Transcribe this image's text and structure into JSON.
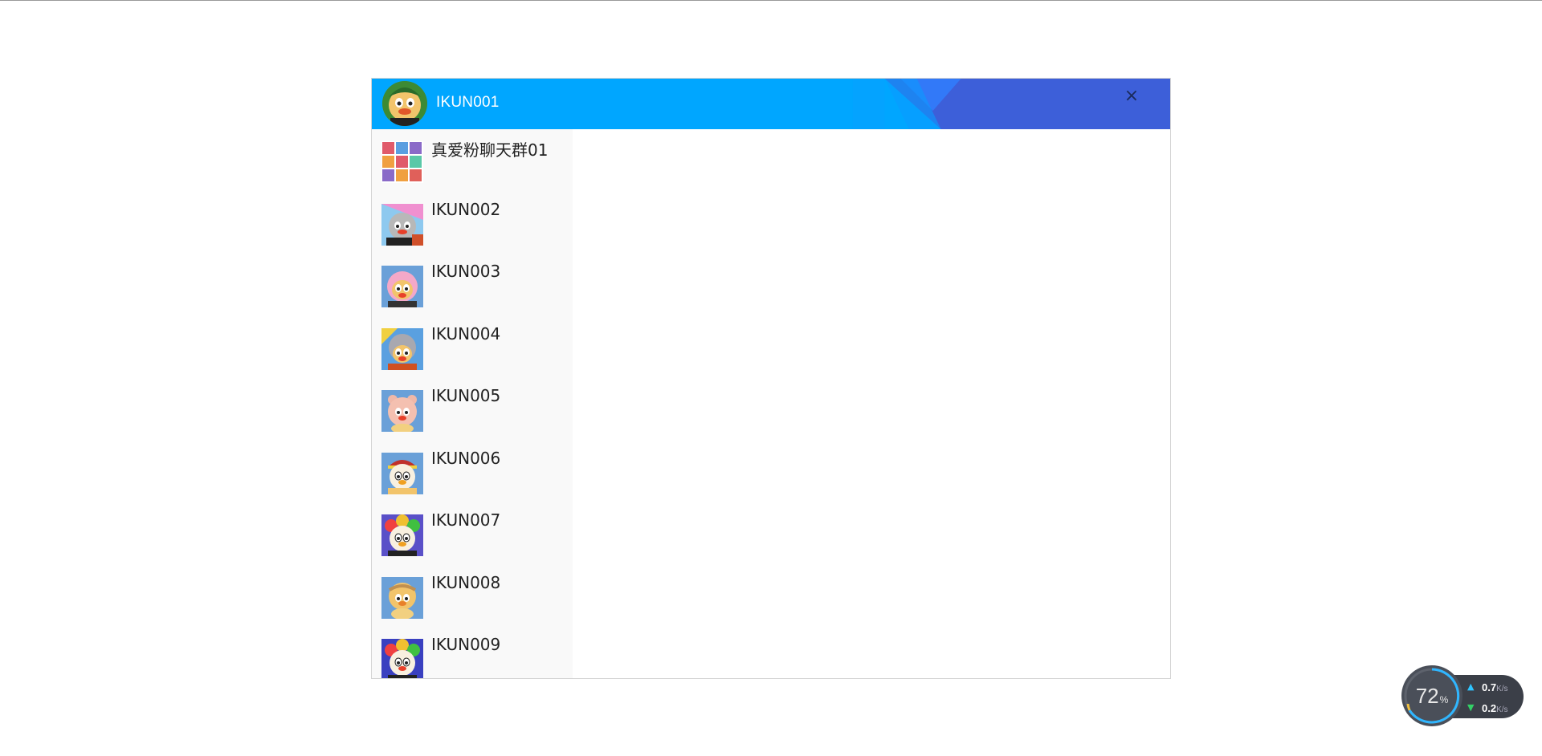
{
  "header": {
    "title": "IKUN001",
    "close_label": "×"
  },
  "contacts": [
    {
      "name": "真爱粉聊天群01",
      "avatar": "group-avatar"
    },
    {
      "name": "IKUN002",
      "avatar": "chick-avatar"
    },
    {
      "name": "IKUN003",
      "avatar": "chick-avatar"
    },
    {
      "name": "IKUN004",
      "avatar": "chick-avatar"
    },
    {
      "name": "IKUN005",
      "avatar": "chick-avatar"
    },
    {
      "name": "IKUN006",
      "avatar": "chick-avatar"
    },
    {
      "name": "IKUN007",
      "avatar": "chick-avatar"
    },
    {
      "name": "IKUN008",
      "avatar": "chick-avatar"
    },
    {
      "name": "IKUN009",
      "avatar": "chick-avatar"
    }
  ],
  "net_widget": {
    "cpu_value": "72",
    "cpu_unit": "%",
    "upload_value": "0.7",
    "upload_unit": "K/s",
    "download_value": "0.2",
    "download_unit": "K/s"
  },
  "colors": {
    "header_blue": "#00a6ff",
    "header_deep": "#3d5fd9",
    "sidebar_bg": "#f9f9f9"
  }
}
